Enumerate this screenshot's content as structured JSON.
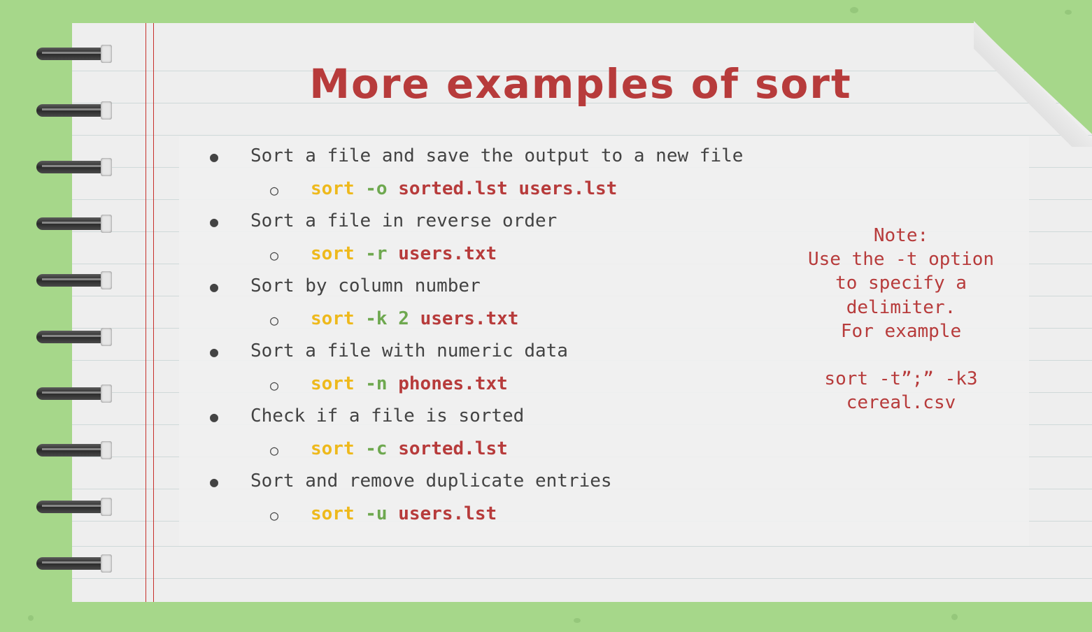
{
  "title": "More examples of sort",
  "items": [
    {
      "text": "Sort a file and save the output to a new file",
      "cmd": "sort",
      "opt": "-o",
      "args": "sorted.lst users.lst"
    },
    {
      "text": "Sort a file in reverse order",
      "cmd": "sort",
      "opt": "-r",
      "args": "users.txt"
    },
    {
      "text": "Sort by column number",
      "cmd": "sort",
      "opt": "-k 2",
      "args": "users.txt"
    },
    {
      "text": "Sort a file with numeric data",
      "cmd": "sort",
      "opt": "-n",
      "args": "phones.txt"
    },
    {
      "text": "Check if a file is sorted",
      "cmd": "sort",
      "opt": "-c",
      "args": "sorted.lst"
    },
    {
      "text": "Sort and remove duplicate entries",
      "cmd": "sort",
      "opt": "-u",
      "args": "users.lst"
    }
  ],
  "bullet_symbol": "●",
  "sub_bullet_symbol": "○",
  "note": "Note:\nUse the -t option\nto specify a\ndelimiter.\nFor example\n\nsort -t”;” -k3\ncereal.csv",
  "colors": {
    "background": "#a6d78a",
    "title": "#b73b3b",
    "command": "#eeb91c",
    "option": "#6ea84f",
    "argument": "#b73b3b",
    "body_text": "#434343"
  }
}
